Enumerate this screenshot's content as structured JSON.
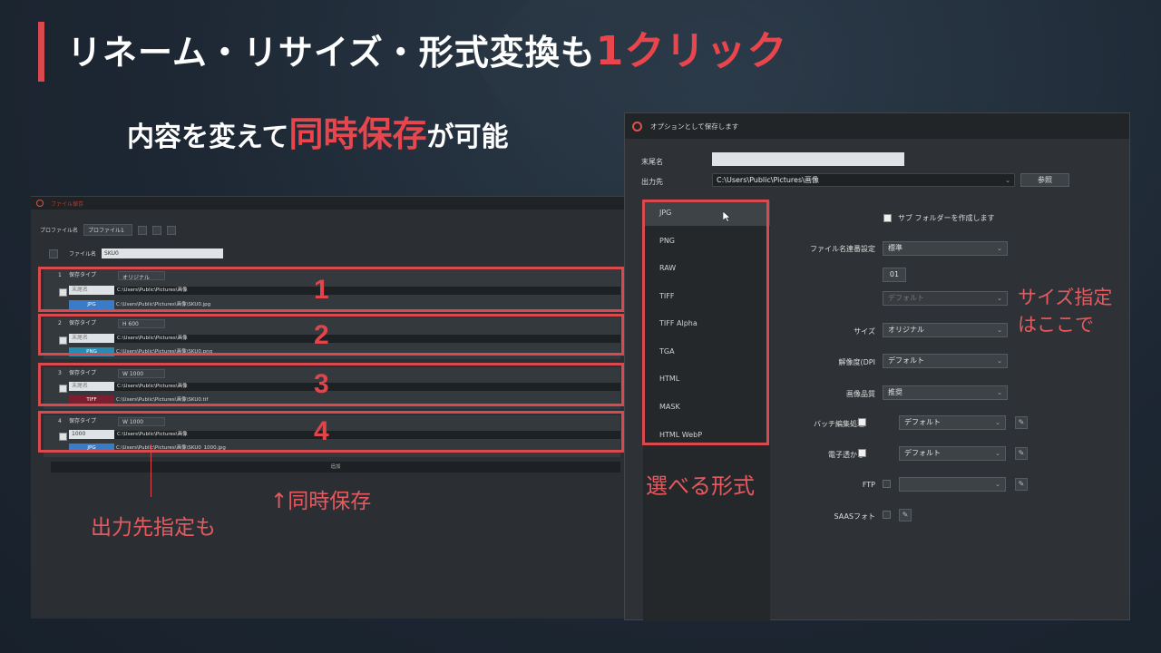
{
  "slide": {
    "title_main": "リネーム・リサイズ・形式変換も",
    "title_accent": "1クリック",
    "subtitle_pre": "内容を変えて",
    "subtitle_accent": "同時保存",
    "subtitle_post": "が可能"
  },
  "left_window": {
    "title": "ファイル保存",
    "profile_label": "プロファイル名",
    "profile_value": "プロファイル1",
    "filename_label": "ファイル名",
    "filename_value": "SKU0",
    "rows": [
      {
        "index": "1",
        "type_label": "保存タイプ",
        "type_value": "オリジナル",
        "suffix": "末尾名",
        "path": "C:\\Users\\Public\\Pictures\\画像",
        "format": "JPG",
        "format_color": "#3a7bc8",
        "output": "C:\\Users\\Public\\Pictures\\画像\\SKU0.jpg"
      },
      {
        "index": "2",
        "type_label": "保存タイプ",
        "type_value": "H 600",
        "suffix": "末尾名",
        "path": "C:\\Users\\Public\\Pictures\\画像",
        "format": "PNG",
        "format_color": "#2a8bb0",
        "output": "C:\\Users\\Public\\Pictures\\画像\\SKU0.png"
      },
      {
        "index": "3",
        "type_label": "保存タイプ",
        "type_value": "W 1000",
        "suffix": "末尾名",
        "path": "C:\\Users\\Public\\Pictures\\画像",
        "format": "TIFF",
        "format_color": "#7a1f2f",
        "output": "C:\\Users\\Public\\Pictures\\画像\\SKU0.tif"
      },
      {
        "index": "4",
        "type_label": "保存タイプ",
        "type_value": "W 1000",
        "suffix": "1000",
        "path": "C:\\Users\\Public\\Pictures\\画像",
        "format": "JPG",
        "format_color": "#3a7bc8",
        "output": "C:\\Users\\Public\\Pictures\\画像\\SKU0_1000.jpg"
      }
    ],
    "add_label": "追加"
  },
  "annotations": {
    "n1": "1",
    "n2": "2",
    "n3": "3",
    "n4": "4",
    "simultaneous": "↑同時保存",
    "output_dest": "出力先指定も",
    "formats": "選べる形式",
    "size_line1": "サイズ指定",
    "size_line2": "はここで"
  },
  "right_window": {
    "title": "オプションとして保存します",
    "suffix_label": "末尾名",
    "suffix_value": "",
    "output_label": "出力先",
    "output_value": "C:\\Users\\Public\\Pictures\\画像",
    "browse_label": "参照",
    "formats": [
      "JPG",
      "PNG",
      "RAW",
      "TIFF",
      "TIFF Alpha",
      "TGA",
      "HTML",
      "MASK",
      "HTML WebP"
    ],
    "selected_format": "JPG",
    "subfolder_label": "サブ フォルダーを作成します",
    "serial_label": "ファイル名連番設定",
    "serial_value": "標準",
    "serial_start": "01",
    "disabled_value": "デフォルト",
    "size_label": "サイズ",
    "size_value": "オリジナル",
    "dpi_label": "解像度(DPI",
    "dpi_value": "デフォルト",
    "quality_label": "画像品質",
    "quality_value": "推奨",
    "batch_label": "バッチ編集処理",
    "batch_value": "デフォルト",
    "watermark_label": "電子透かし",
    "watermark_value": "デフォルト",
    "ftp_label": "FTP",
    "ftp_value": "",
    "saas_label": "SAASフォト"
  }
}
